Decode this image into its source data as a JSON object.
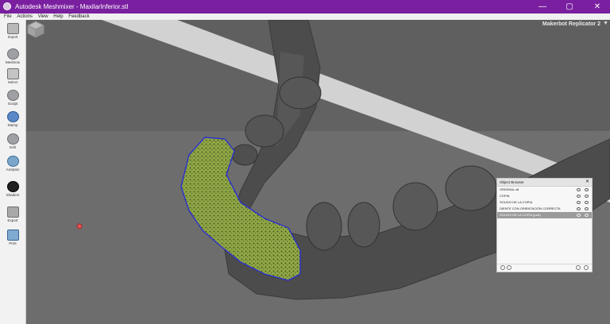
{
  "window": {
    "title": "Autodesk Meshmixer - MaxilarInferior.stl",
    "minimize_glyph": "—",
    "maximize_glyph": "▢",
    "close_glyph": "✕"
  },
  "menu": [
    "File",
    "Actions",
    "View",
    "Help",
    "Feedback"
  ],
  "toolbar": [
    {
      "label": "Import",
      "icon": "plus-icon"
    },
    {
      "label": "Meshmix",
      "icon": "meshmix-icon"
    },
    {
      "label": "Select",
      "icon": "select-arrow-icon"
    },
    {
      "label": "Sculpt",
      "icon": "brush-icon"
    },
    {
      "label": "Stamp",
      "icon": "stamp-icon"
    },
    {
      "label": "Edit",
      "icon": "edit-icon"
    },
    {
      "label": "Analysis",
      "icon": "analysis-icon"
    },
    {
      "label": "Shaders",
      "icon": "shader-sphere-icon"
    },
    {
      "label": "Export",
      "icon": "export-folder-icon"
    },
    {
      "label": "Print",
      "icon": "print-icon"
    }
  ],
  "viewport": {
    "printer": "Makerbot Replicator 2",
    "dropdown_glyph": "▼"
  },
  "object_browser": {
    "title": "Object Browser",
    "close_glyph": "✕",
    "items": [
      {
        "name": "ORIGINAL.stl",
        "selected": false
      },
      {
        "name": "COPIA",
        "selected": false
      },
      {
        "name": "SOLIDO DE LA COPIA",
        "selected": false
      },
      {
        "name": "DIENTE CON ORIENTACIÓN CORRECTA",
        "selected": false
      },
      {
        "name": "SOLIDO DE LA COPIA (part)",
        "selected": true
      }
    ]
  },
  "colors": {
    "titlebar": "#7a1fa0",
    "mesh": "#4b4b4b",
    "selection_green": "#8aa040",
    "selection_outline": "#2a2fd0"
  }
}
